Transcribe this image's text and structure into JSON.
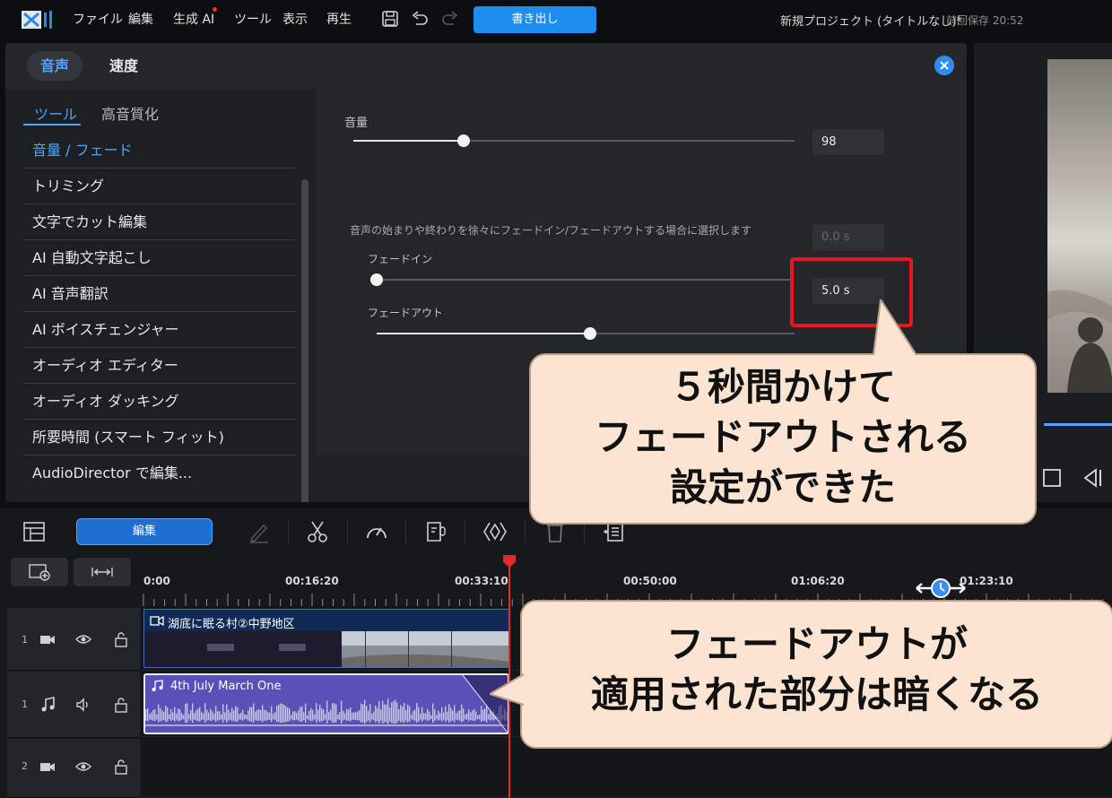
{
  "menubar": {
    "items": [
      "ファイル",
      "編集",
      "生成 AI",
      "ツール",
      "表示",
      "再生"
    ],
    "export_label": "書き出し",
    "project_title": "新規プロジェクト (タイトルなし)*",
    "saved_label": "前回保存 20:52"
  },
  "panel": {
    "tabs": [
      "音声",
      "速度"
    ],
    "subtabs": [
      "ツール",
      "高音質化"
    ],
    "side_items": [
      "音量 / フェード",
      "トリミング",
      "文字でカット編集",
      "AI 自動文字起こし",
      "AI 音声翻訳",
      "AI ボイスチェンジャー",
      "オーディオ エディター",
      "オーディオ ダッキング",
      "所要時間 (スマート フィット)",
      "AudioDirector で編集..."
    ],
    "volume_label": "音量",
    "volume_value": "98",
    "volume_level": 0.25,
    "fade_description": "音声の始まりや終わりを徐々にフェードイン/フェードアウトする場合に選択します",
    "fade_in_label": "フェードイン",
    "fade_in_value": "0.0 s",
    "fade_in_level": 0.0,
    "fade_out_label": "フェードアウト",
    "fade_out_value": "5.0 s",
    "fade_out_level": 0.51
  },
  "timeline": {
    "edit_label": "編集",
    "times": [
      "0:00",
      "00:16:20",
      "00:33:10",
      "00:50:00",
      "01:06:20",
      "01:23:10"
    ],
    "tracks": [
      "1",
      "1",
      "2"
    ],
    "video_clip_title": "湖底に眠る村②中野地区",
    "audio_clip_title": "4th July March One"
  },
  "callouts": {
    "top": [
      "５秒間かけて",
      "フェードアウトされる",
      "設定ができた"
    ],
    "bottom": [
      "フェードアウトが",
      "適用された部分は暗くなる"
    ]
  },
  "colors": {
    "accent": "#1f8cf0",
    "highlight": "#e8171e",
    "callout_bg": "#fbe5d2",
    "audio_clip": "#5a50b8"
  }
}
